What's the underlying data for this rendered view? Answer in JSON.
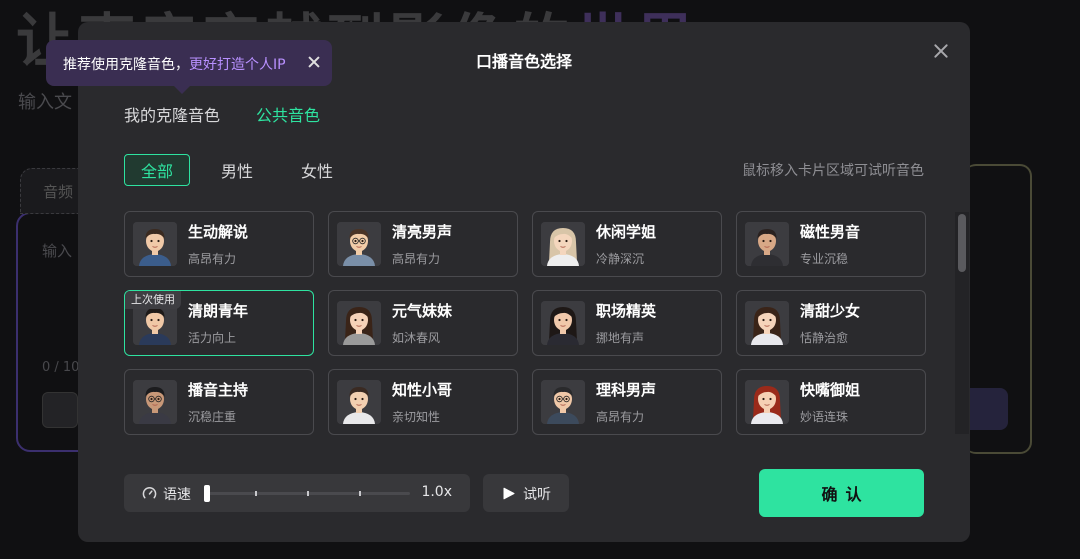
{
  "background": {
    "hero_a": "让",
    "hero_b": "声音穿越到影像的",
    "hero_c": "世界",
    "sub": "输入文",
    "tab_label": "音频",
    "input_label": "输入",
    "count": "0 / 10"
  },
  "tooltip": {
    "text_prefix": "推荐使用克隆音色，",
    "text_highlight": "更好打造个人IP"
  },
  "modal": {
    "title": "口播音色选择",
    "source_tabs": [
      {
        "label": "我的克隆音色",
        "active": false
      },
      {
        "label": "公共音色",
        "active": true
      }
    ],
    "filters": [
      {
        "label": "全部",
        "active": true
      },
      {
        "label": "男性",
        "active": false
      },
      {
        "label": "女性",
        "active": false
      }
    ],
    "hint": "鼠标移入卡片区域可试听音色",
    "last_used_badge": "上次使用",
    "voices": [
      {
        "name": "生动解说",
        "desc": "高昂有力",
        "gender": "male",
        "hair": "#3a2a20",
        "skin": "#f0c9a8",
        "shirt": "#3b5d8c"
      },
      {
        "name": "清亮男声",
        "desc": "高昂有力",
        "gender": "male",
        "hair": "#4a3426",
        "skin": "#f2cda8",
        "shirt": "#7a8fa8",
        "glasses": true
      },
      {
        "name": "休闲学姐",
        "desc": "冷静深沉",
        "gender": "female",
        "hair": "#d8c5a8",
        "skin": "#f4d6bd",
        "shirt": "#eeeeee"
      },
      {
        "name": "磁性男音",
        "desc": "专业沉稳",
        "gender": "male",
        "hair": "#2a2220",
        "skin": "#d8a886",
        "shirt": "#2e2e32"
      },
      {
        "name": "清朗青年",
        "desc": "活力向上",
        "gender": "male",
        "hair": "#1e1a18",
        "skin": "#f0c8a6",
        "shirt": "#2a3a5a",
        "selected": true
      },
      {
        "name": "元气妹妹",
        "desc": "如沐春风",
        "gender": "female",
        "hair": "#3a2418",
        "skin": "#f6d2b8",
        "shirt": "#9a9a9a"
      },
      {
        "name": "职场精英",
        "desc": "挪地有声",
        "gender": "female",
        "hair": "#1e1816",
        "skin": "#f0c8aa",
        "shirt": "#2a2a32"
      },
      {
        "name": "清甜少女",
        "desc": "恬静治愈",
        "gender": "female",
        "hair": "#3a2418",
        "skin": "#f6d4ba",
        "shirt": "#e8e8ec"
      },
      {
        "name": "播音主持",
        "desc": "沉稳庄重",
        "gender": "male",
        "hair": "#1c1c1e",
        "skin": "#c89878",
        "shirt": "#3a3a44",
        "glasses": true
      },
      {
        "name": "知性小哥",
        "desc": "亲切知性",
        "gender": "male",
        "hair": "#3a2a22",
        "skin": "#f2cfb0",
        "shirt": "#e8e8ea"
      },
      {
        "name": "理科男声",
        "desc": "高昂有力",
        "gender": "male",
        "hair": "#2a2a2c",
        "skin": "#f0c8a8",
        "shirt": "#3c4a5c",
        "glasses": true
      },
      {
        "name": "快嘴御姐",
        "desc": "妙语连珠",
        "gender": "female",
        "hair": "#9a2a1a",
        "skin": "#f6d0b4",
        "shirt": "#eaeaee"
      }
    ],
    "speed": {
      "label": "语速",
      "value": "1.0x"
    },
    "preview_label": "试听",
    "confirm_label": "确认"
  },
  "colors": {
    "accent": "#2ee3a0",
    "tooltip_bg": "#3a2e52",
    "tooltip_highlight": "#b890ff",
    "modal_bg": "#2a2a2d"
  },
  "icons": {
    "close": "close-icon",
    "speed": "speed-gauge-icon",
    "play": "play-icon"
  }
}
